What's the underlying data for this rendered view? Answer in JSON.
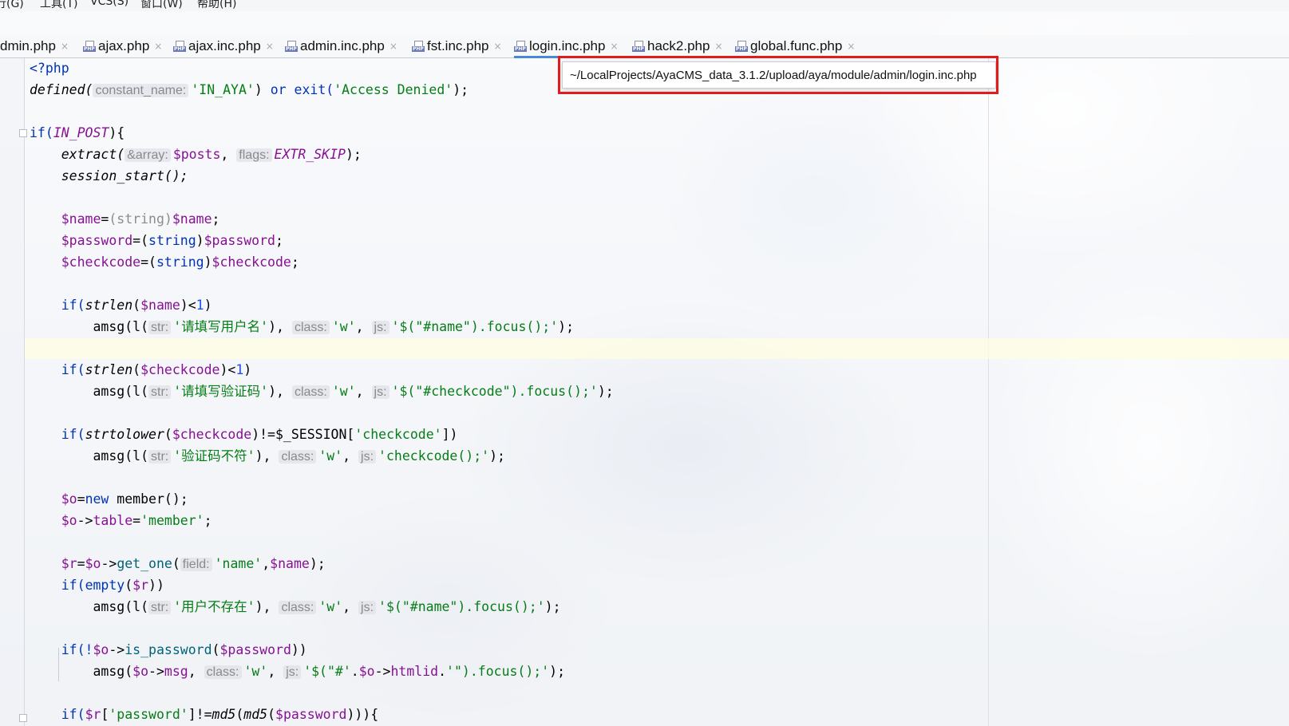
{
  "menubar": {
    "items": [
      "行(G)",
      "工具(T)",
      "VCS(S)",
      "窗口(W)",
      "帮助(H)"
    ]
  },
  "tabs": [
    {
      "label": "dmin.php",
      "icon": "php-file-icon",
      "active": false
    },
    {
      "label": "ajax.php",
      "icon": "php-file-icon",
      "active": false
    },
    {
      "label": "ajax.inc.php",
      "icon": "php-file-icon",
      "active": false
    },
    {
      "label": "admin.inc.php",
      "icon": "php-file-icon",
      "active": false
    },
    {
      "label": "fst.inc.php",
      "icon": "php-file-icon",
      "active": false
    },
    {
      "label": "login.inc.php",
      "icon": "php-file-icon",
      "active": true
    },
    {
      "label": "hack2.php",
      "icon": "php-file-icon",
      "active": false
    },
    {
      "label": "global.func.php",
      "icon": "php-file-icon",
      "active": false
    }
  ],
  "tab_close_symbol": "×",
  "tooltip": {
    "path": "~/LocalProjects/AyaCMS_data_3.1.2/upload/aya/module/admin/login.inc.php",
    "highlight_color": "#e21b1b"
  },
  "code": {
    "l1": "<?php",
    "l2_fn": "defined(",
    "l2_hint": "constant_name:",
    "l2_str1": "'IN_AYA'",
    "l2_mid": ") ",
    "l2_or": "or",
    "l2_exit": " exit(",
    "l2_str2": "'Access Denied'",
    "l2_end": ");",
    "l4_if": "if(",
    "l4_const": "IN_POST",
    "l4_end": "){",
    "l5_fn": "extract(",
    "l5_hint1": "&array:",
    "l5_var": "$posts",
    "l5_comma": ", ",
    "l5_hint2": "flags:",
    "l5_const": "EXTR_SKIP",
    "l5_end": ");",
    "l6": "session_start();",
    "l8_var1": "$name",
    "l8_eq": "=",
    "l8_cast": "(string)",
    "l8_var2": "$name",
    "l8_end": ";",
    "l9_var1": "$password",
    "l9_eq": "=(",
    "l9_kw": "string",
    "l9_cl": ")",
    "l9_var2": "$password",
    "l9_end": ";",
    "l10_var1": "$checkcode",
    "l10_eq": "=(",
    "l10_kw": "string",
    "l10_cl": ")",
    "l10_var2": "$checkcode",
    "l10_end": ";",
    "l12_if": "if(",
    "l12_fn": "strlen",
    "l12_op": "(",
    "l12_var": "$name",
    "l12_lt": ")<",
    "l12_num": "1",
    "l12_end": ")",
    "l13_fn": "amsg(l(",
    "l13_hint1": "str:",
    "l13_str1": "'请填写用户名'",
    "l13_sep1": "), ",
    "l13_hint2": "class:",
    "l13_str2": "'w'",
    "l13_sep2": ", ",
    "l13_hint3": "js:",
    "l13_str3": "'$(\"#name\").focus();'",
    "l13_end": ");",
    "l15_if": "if(",
    "l15_fn": "strlen",
    "l15_op": "(",
    "l15_var": "$checkcode",
    "l15_lt": ")<",
    "l15_num": "1",
    "l15_end": ")",
    "l16_fn": "amsg(l(",
    "l16_hint1": "str:",
    "l16_str1": "'请填写验证码'",
    "l16_sep1": "), ",
    "l16_hint2": "class:",
    "l16_str2": "'w'",
    "l16_sep2": ", ",
    "l16_hint3": "js:",
    "l16_str3": "'$(\"#checkcode\").focus();'",
    "l16_end": ");",
    "l18_if": "if(",
    "l18_fn": "strtolower",
    "l18_op": "(",
    "l18_var": "$checkcode",
    "l18_ne": ")!=$_SESSION[",
    "l18_str": "'checkcode'",
    "l18_end": "])",
    "l19_fn": "amsg(l(",
    "l19_hint1": "str:",
    "l19_str1": "'验证码不符'",
    "l19_sep1": "), ",
    "l19_hint2": "class:",
    "l19_str2": "'w'",
    "l19_sep2": ", ",
    "l19_hint3": "js:",
    "l19_str3": "'checkcode();'",
    "l19_end": ");",
    "l21_var": "$o",
    "l21_eq": "=",
    "l21_kw": "new",
    "l21_rest": " member();",
    "l22_var": "$o",
    "l22_arrow": "->",
    "l22_prop": "table",
    "l22_eq": "=",
    "l22_str": "'member'",
    "l22_end": ";",
    "l24_var1": "$r",
    "l24_eq": "=",
    "l24_var2": "$o",
    "l24_arrow": "->",
    "l24_meth": "get_one",
    "l24_op": "(",
    "l24_hint": "field:",
    "l24_str": "'name'",
    "l24_comma": ",",
    "l24_var3": "$name",
    "l24_end": ");",
    "l25_if": "if(",
    "l25_kw": "empty",
    "l25_op": "(",
    "l25_var": "$r",
    "l25_end": "))",
    "l26_fn": "amsg(l(",
    "l26_hint1": "str:",
    "l26_str1": "'用户不存在'",
    "l26_sep1": "), ",
    "l26_hint2": "class:",
    "l26_str2": "'w'",
    "l26_sep2": ", ",
    "l26_hint3": "js:",
    "l26_str3": "'$(\"#name\").focus();'",
    "l26_end": ");",
    "l28_if": "if(!",
    "l28_var": "$o",
    "l28_arrow": "->",
    "l28_meth": "is_password",
    "l28_op": "(",
    "l28_var2": "$password",
    "l28_end": "))",
    "l29_fn": "amsg(",
    "l29_var": "$o",
    "l29_arrow": "->",
    "l29_prop": "msg",
    "l29_sep1": ", ",
    "l29_hint2": "class:",
    "l29_str2": "'w'",
    "l29_sep2": ", ",
    "l29_hint3": "js:",
    "l29_str3a": "'$(\"#'",
    "l29_dot1": ".",
    "l29_var2": "$o",
    "l29_arrow2": "->",
    "l29_prop2": "htmlid",
    "l29_dot2": ".",
    "l29_str3b": "'\").focus();'",
    "l29_end": ");",
    "l31_if": "if(",
    "l31_var": "$r",
    "l31_br": "[",
    "l31_str": "'password'",
    "l31_ne": "]!=",
    "l31_fn1": "md5",
    "l31_op1": "(",
    "l31_fn2": "md5",
    "l31_op2": "(",
    "l31_var2": "$password",
    "l31_end": "))){"
  }
}
